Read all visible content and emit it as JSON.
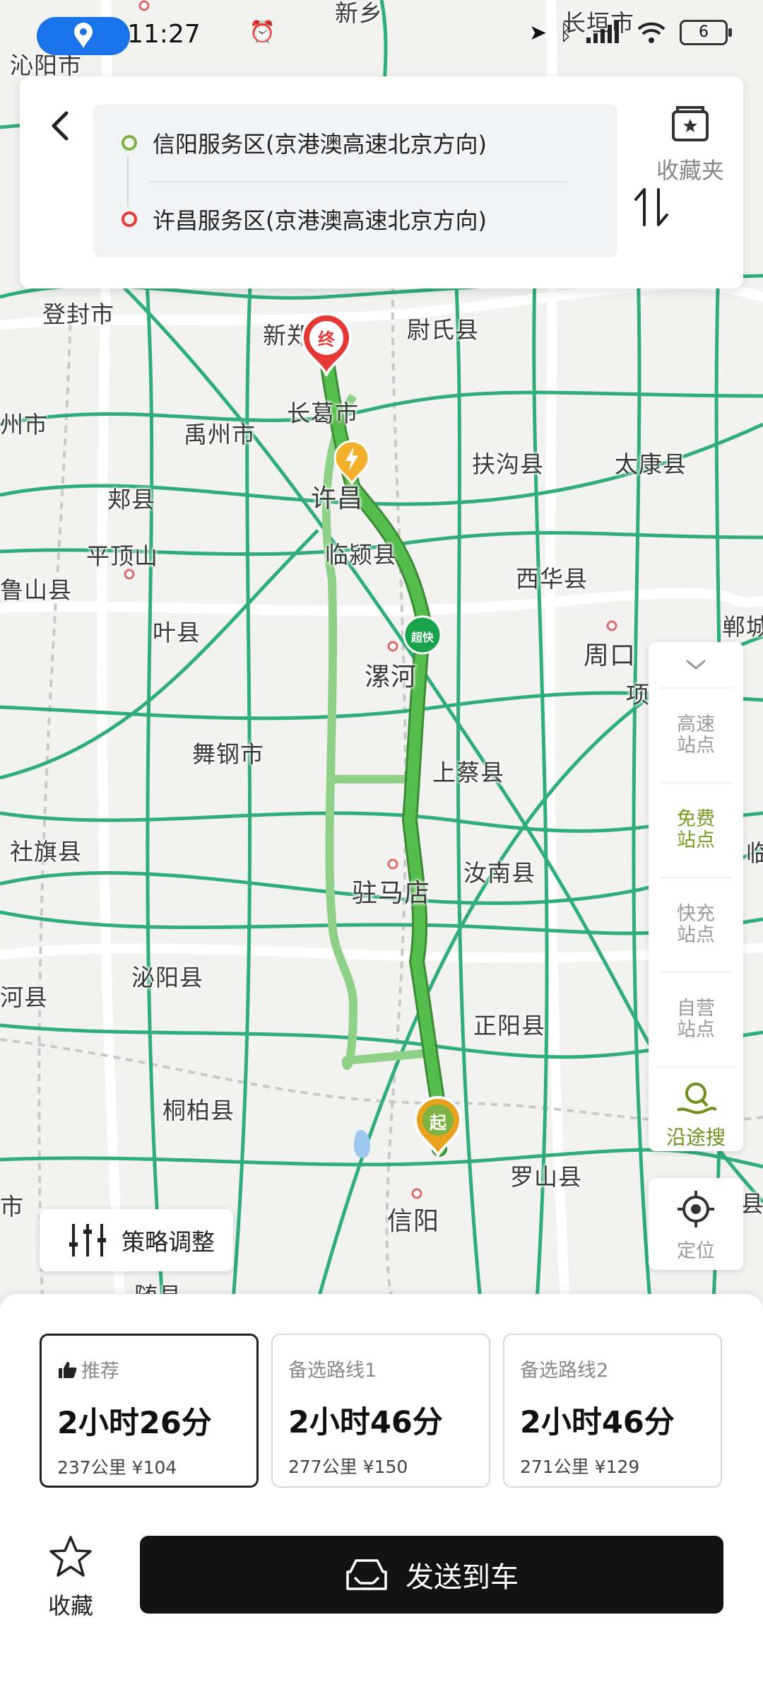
{
  "status_bar": {
    "time": "11:27",
    "battery": "6"
  },
  "route": {
    "back_icon": "chevron-left-icon",
    "start": "信阳服务区(京港澳高速北京方向)",
    "end": "许昌服务区(京港澳高速北京方向)",
    "swap_icon": "swap-icon",
    "favorites_folder_label": "收藏夹"
  },
  "map": {
    "places": [
      "沁阳市",
      "登封市",
      "新郑",
      "尉氏县",
      "长葛市",
      "禹州市",
      "许昌",
      "扶沟县",
      "太康县",
      "郏县",
      "平顶山",
      "临颍县",
      "西华县",
      "鲁山县",
      "叶县",
      "漯河",
      "周口",
      "项",
      "郸城",
      "舞钢市",
      "上蔡县",
      "社旗县",
      "驻马店",
      "汝南县",
      "泌阳县",
      "正阳县",
      "河县",
      "桐柏县",
      "罗山县",
      "信阳",
      "随县",
      "县",
      "市",
      "州市",
      "长垣市",
      "新乡",
      "临"
    ],
    "markers": {
      "end_label": "终",
      "start_label": "起",
      "supercharger_label": "超快"
    }
  },
  "side_panel": {
    "items": [
      {
        "label": "高速站点",
        "active": false
      },
      {
        "label": "免费站点",
        "active": true
      },
      {
        "label": "快充站点",
        "active": false
      },
      {
        "label": "自营站点",
        "active": false
      }
    ],
    "search_label": "沿途搜",
    "locate_label": "定位"
  },
  "strategy_label": "策略调整",
  "route_options": [
    {
      "tag": "推荐",
      "time": "2小时26分",
      "meta": "237公里 ¥104",
      "selected": true
    },
    {
      "tag": "备选路线1",
      "time": "2小时46分",
      "meta": "277公里 ¥150",
      "selected": false
    },
    {
      "tag": "备选路线2",
      "time": "2小时46分",
      "meta": "271公里 ¥129",
      "selected": false
    }
  ],
  "favorite_label": "收藏",
  "send_label": "发送到车",
  "colors": {
    "route_main": "#52b84a",
    "route_alt": "#8fd088",
    "road_green": "#2fae7a",
    "start_dot": "#7cb342",
    "end_dot": "#e53935",
    "active_side": "#7a9a20"
  }
}
